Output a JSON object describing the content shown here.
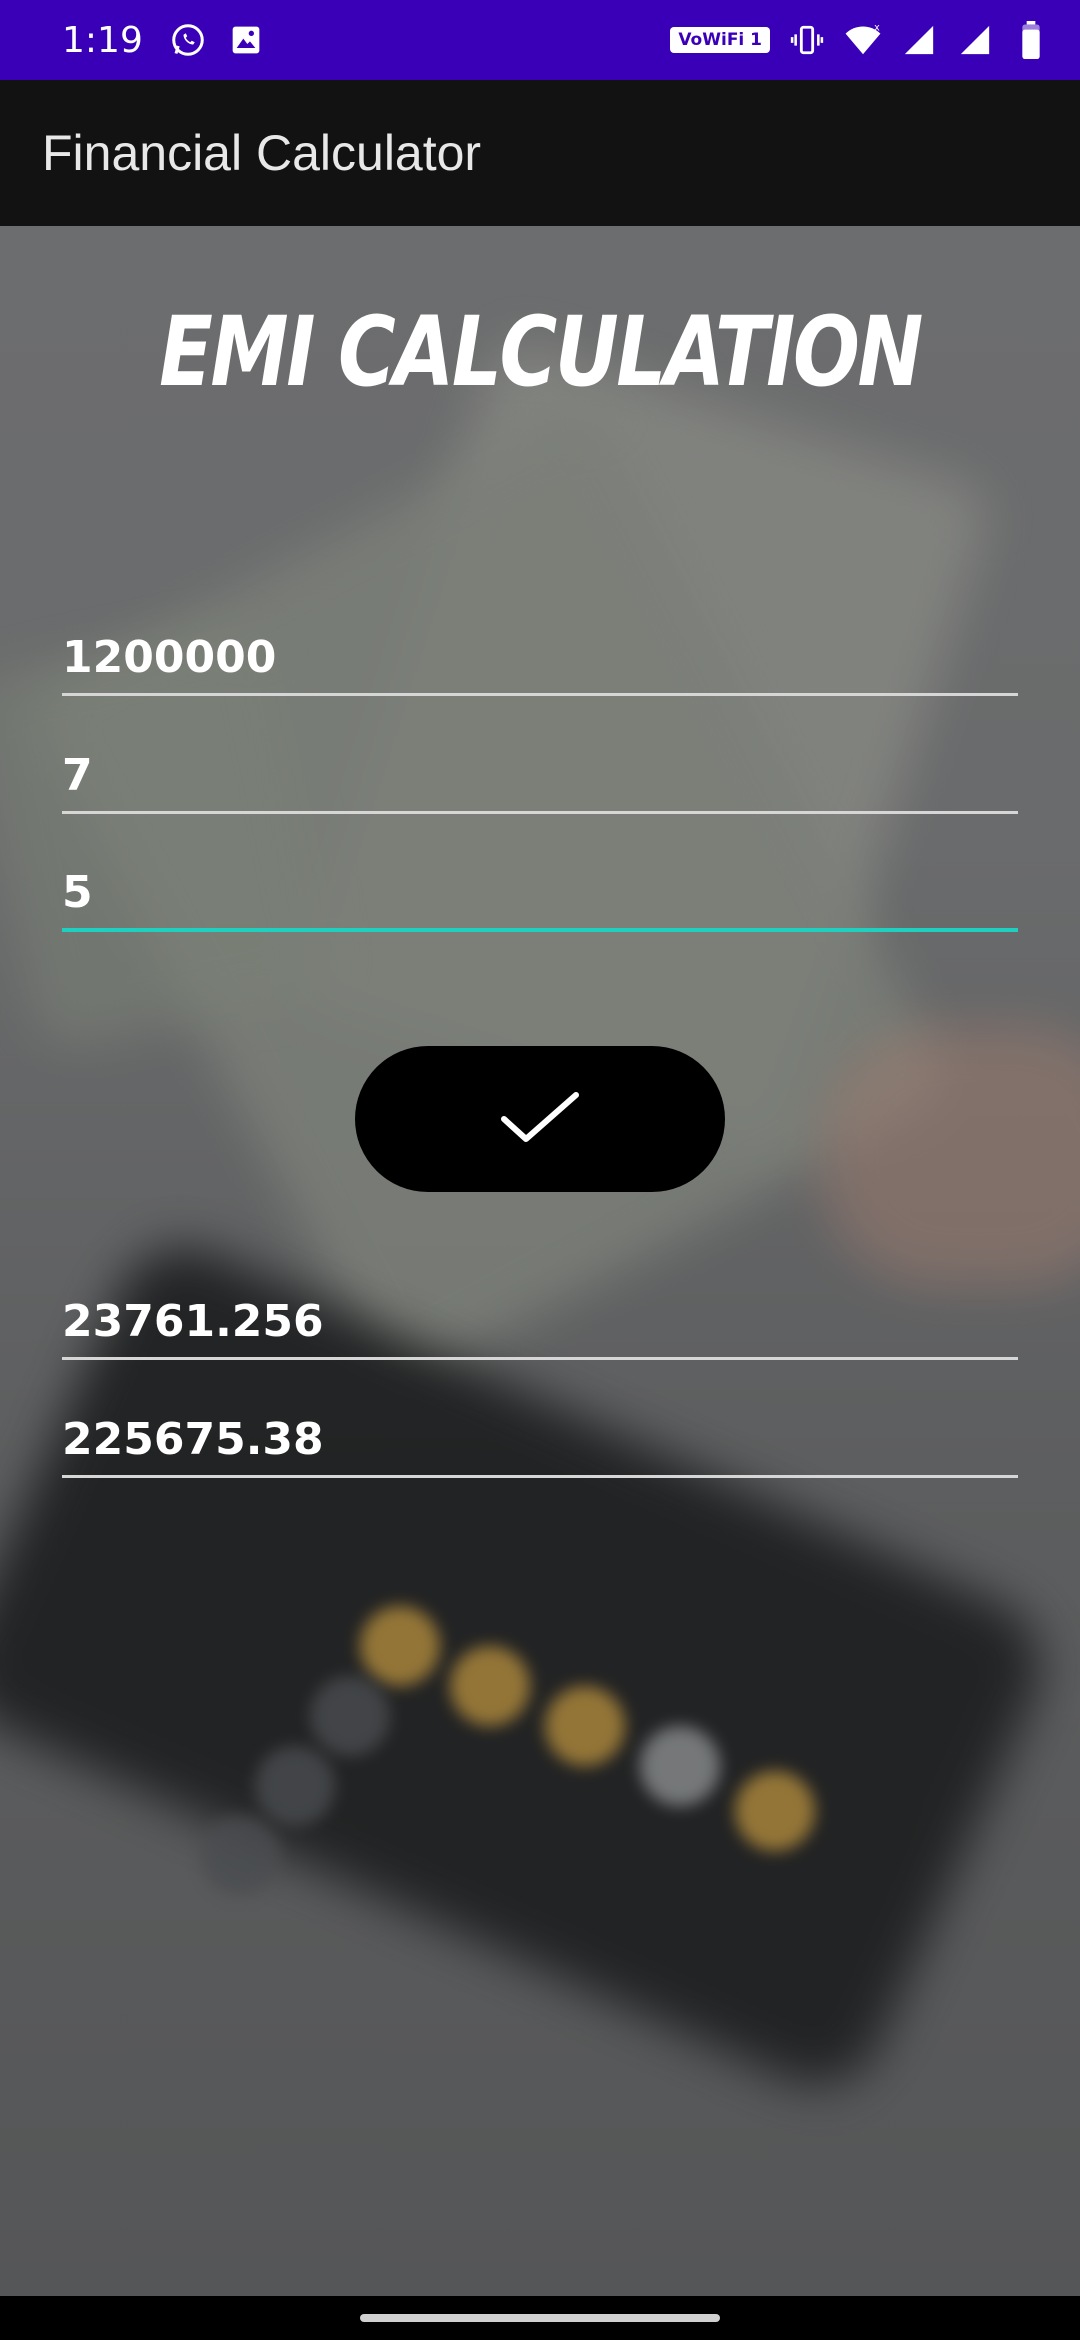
{
  "status_bar": {
    "time": "1:19",
    "wifi_badge": "VoWiFi 1",
    "icons": [
      "whatsapp-icon",
      "image-icon",
      "vibrate-icon",
      "wifi-icon",
      "signal-icon",
      "signal-icon",
      "battery-icon"
    ]
  },
  "app_bar": {
    "title": "Financial Calculator"
  },
  "main": {
    "heading": "EMI CALCULATION",
    "inputs": {
      "principal": "1200000",
      "rate": "7",
      "tenure": "5"
    },
    "submit_icon": "check-icon",
    "results": {
      "emi": "23761.256",
      "interest": "225675.38"
    }
  },
  "colors": {
    "status_bar": "#3a00b8",
    "app_bar": "#121212",
    "accent": "#1fcfbf",
    "button": "#000000"
  }
}
